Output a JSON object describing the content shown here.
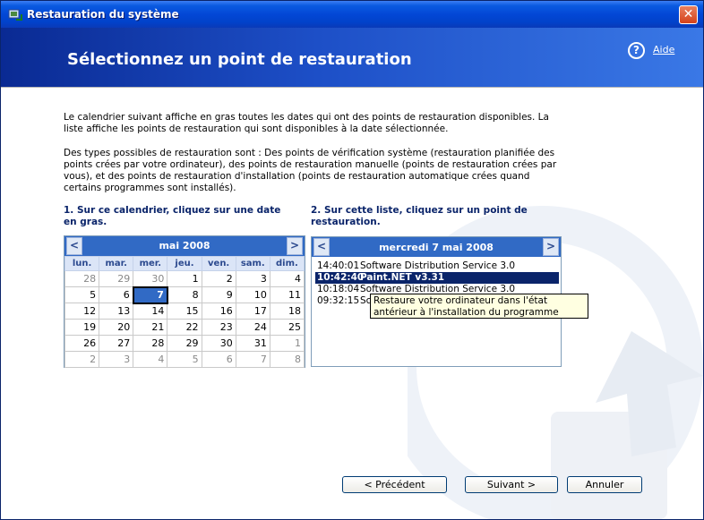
{
  "window": {
    "title": "Restauration du système",
    "close_label": "✕"
  },
  "banner": {
    "title": "Sélectionnez un point de restauration",
    "help_glyph": "?",
    "help_label": "Aide"
  },
  "intro": {
    "paragraph1": "Le calendrier suivant affiche en gras toutes les dates qui ont des points de restauration disponibles. La liste affiche les points de restauration qui sont disponibles à la date sélectionnée.",
    "paragraph2": "Des types possibles de restauration sont : Des points de vérification système (restauration planifiée des points crées par votre ordinateur), des points de restauration manuelle (points de restauration crées par vous), et des points de restauration d'installation (points de restauration automatique crées quand certains programmes sont installés)."
  },
  "step1": {
    "label": "1. Sur ce calendrier, cliquez sur une date en gras."
  },
  "step2": {
    "label": "2. Sur cette liste, cliquez sur un point de restauration."
  },
  "calendar": {
    "prev": "<",
    "next": ">",
    "month": "mai 2008",
    "weekdays": [
      "lun.",
      "mar.",
      "mer.",
      "jeu.",
      "ven.",
      "sam.",
      "dim."
    ],
    "weeks": [
      [
        "28",
        "29",
        "30",
        "1",
        "2",
        "3",
        "4"
      ],
      [
        "5",
        "6",
        "7",
        "8",
        "9",
        "10",
        "11"
      ],
      [
        "12",
        "13",
        "14",
        "15",
        "16",
        "17",
        "18"
      ],
      [
        "19",
        "20",
        "21",
        "22",
        "23",
        "24",
        "25"
      ],
      [
        "26",
        "27",
        "28",
        "29",
        "30",
        "31",
        "1"
      ],
      [
        "2",
        "3",
        "4",
        "5",
        "6",
        "7",
        "8"
      ]
    ],
    "selected": "7"
  },
  "restore_list": {
    "prev": "<",
    "next": ">",
    "date": "mercredi 7 mai 2008",
    "items": [
      {
        "time": "14:40:01",
        "desc": "Software Distribution Service 3.0"
      },
      {
        "time": "10:42:40",
        "desc": "Paint.NET v3.31"
      },
      {
        "time": "10:18:04",
        "desc": "Software Distribution Service 3.0"
      },
      {
        "time": "09:32:15",
        "desc": "Sc"
      }
    ]
  },
  "tooltip": {
    "text": "Restaure votre ordinateur dans l'état antérieur à l'installation du programme"
  },
  "buttons": {
    "previous": "< Précédent",
    "next": "Suivant >",
    "cancel": "Annuler"
  },
  "colors": {
    "titlebar": "#0347d6",
    "banner_dark": "#0a2a93",
    "selection": "#316ac5",
    "list_selection": "#0a246a",
    "tooltip_bg": "#ffffe1",
    "step_text": "#0a246a"
  }
}
